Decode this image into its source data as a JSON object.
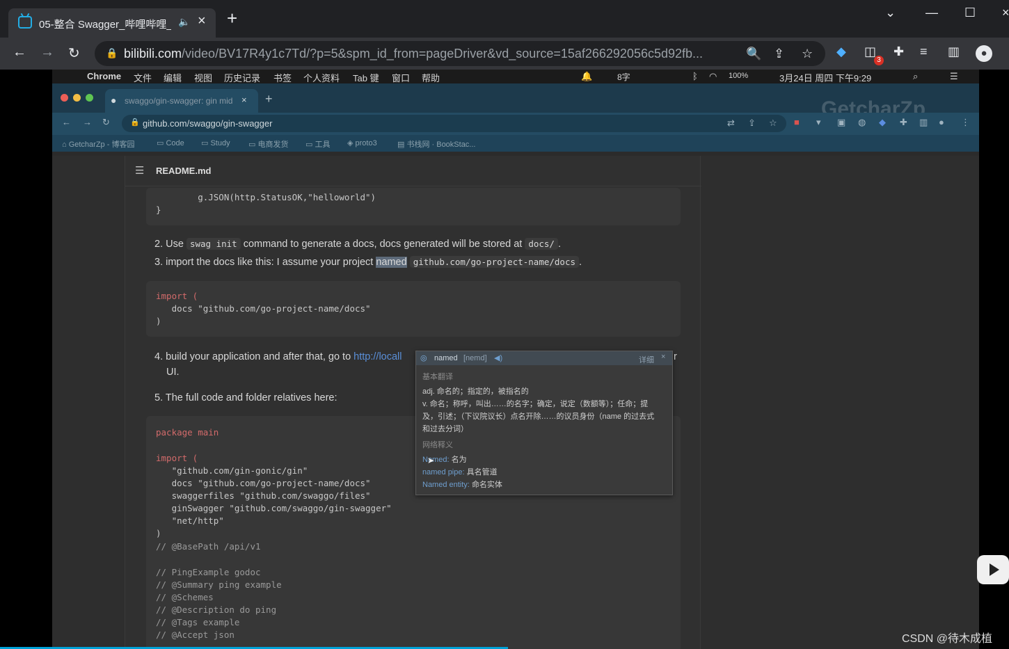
{
  "outer_browser": {
    "tab_title": "05-整合 Swagger_哔哩哔哩_",
    "url_host": "bilibili.com",
    "url_path": "/video/BV17R4y1c7Td/?p=5&spm_id_from=pageDriver&vd_source=15af266292056c5d92fb...",
    "extension_badge": "3"
  },
  "mac_menubar": {
    "app": "Chrome",
    "items": [
      "文件",
      "编辑",
      "视图",
      "历史记录",
      "书签",
      "个人资料",
      "Tab 键",
      "窗口",
      "帮助"
    ],
    "status_right": "8字",
    "battery": "100%",
    "datetime": "3月24日 周四 下午9:29"
  },
  "inner_browser": {
    "tab_title": "swaggo/gin-swagger: gin mid",
    "url": "github.com/swaggo/gin-swagger",
    "watermark": "GetcharZp",
    "bookmarks": [
      "GetcharZp - 博客园",
      "Code",
      "Study",
      "电商发货",
      "工具",
      "proto3",
      "书栈网 · BookStac..."
    ]
  },
  "readme": {
    "file_name": "README.md",
    "code_top": [
      "        g.JSON(http.StatusOK,\"helloworld\")",
      "}"
    ],
    "step2": {
      "pre": "2. Use ",
      "code": "swag init",
      "mid": " command to generate a docs, docs generated will be stored at ",
      "code2": "docs/",
      "post": "."
    },
    "step3": {
      "pre": "3. import the docs like this: I assume your project ",
      "highlight": "named",
      "code": "github.com/go-project-name/docs",
      "post": "."
    },
    "import_block": [
      "import (",
      "   docs \"github.com/go-project-name/docs\"",
      ")"
    ],
    "step4": {
      "pre": "4. build your application and after that, go to ",
      "link": "http://locall",
      "tail": "r",
      "line2": "UI."
    },
    "step5": "5. The full code and folder relatives here:",
    "main_code": [
      "package main",
      "",
      "import (",
      "   \"github.com/gin-gonic/gin\"",
      "   docs \"github.com/go-project-name/docs\"",
      "   swaggerfiles \"github.com/swaggo/files\"",
      "   ginSwagger \"github.com/swaggo/gin-swagger\"",
      "   \"net/http\"",
      ")",
      "// @BasePath /api/v1",
      "",
      "// PingExample godoc",
      "// @Summary ping example",
      "// @Schemes",
      "// @Description do ping",
      "// @Tags example",
      "// @Accept json"
    ]
  },
  "dictionary": {
    "word": "named",
    "phonetic": "[nemd]",
    "detail_label": "详细",
    "basic_title": "基本翻译",
    "basic_lines": [
      "adj. 命名的；指定的，被指名的",
      "v. 命名；称呼，叫出……的名字；确定，说定（数额等）；任命；提",
      "及，引述；（下议院议长）点名开除……的议员身份（name 的过去式",
      "和过去分词）"
    ],
    "web_title": "网络释义",
    "web_items": [
      {
        "term": "Named:",
        "meaning": "名为"
      },
      {
        "term": "named pipe:",
        "meaning": "具名管道"
      },
      {
        "term": "Named entity:",
        "meaning": "命名实体"
      }
    ]
  },
  "overlay": {
    "csdn_watermark": "CSDN @待木成植"
  }
}
